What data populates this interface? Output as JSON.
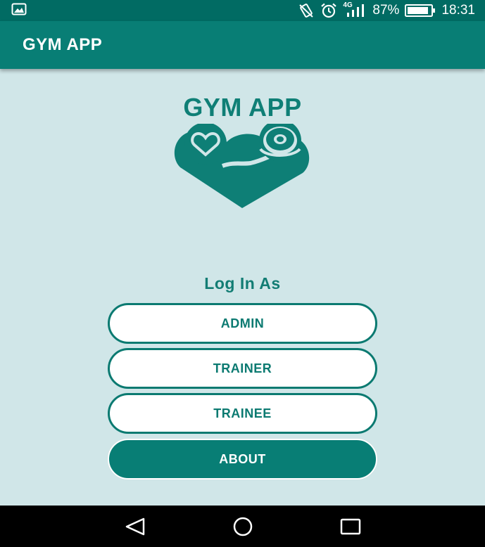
{
  "status_bar": {
    "network": "4G",
    "battery": "87%",
    "time": "18:31",
    "icons": [
      "gallery-icon",
      "vibrate-off-icon",
      "alarm-icon",
      "signal-icon",
      "battery-icon"
    ]
  },
  "app_bar": {
    "title": "GYM APP"
  },
  "brand": {
    "title": "GYM APP",
    "logo_icon": "heart-dumbbell-logo-icon"
  },
  "login": {
    "label": "Log In As",
    "buttons": {
      "admin": "ADMIN",
      "trainer": "TRAINER",
      "trainee": "TRAINEE",
      "about": "ABOUT"
    }
  },
  "nav_bar": {
    "icons": [
      "back-icon",
      "home-icon",
      "recents-icon"
    ]
  },
  "colors": {
    "primary": "#087e75",
    "primary_dark": "#016b63",
    "background": "#d0e6e8",
    "button_bg": "#ffffff"
  }
}
